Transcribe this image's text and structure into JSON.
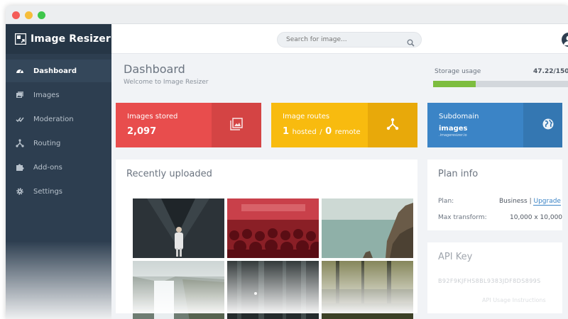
{
  "app": {
    "name": "Image Resizer"
  },
  "window": {
    "controls": [
      "close",
      "minimize",
      "maximize"
    ]
  },
  "sidebar": {
    "items": [
      {
        "label": "Dashboard",
        "icon": "dashboard-icon",
        "active": true
      },
      {
        "label": "Images",
        "icon": "images-icon",
        "active": false
      },
      {
        "label": "Moderation",
        "icon": "moderation-icon",
        "active": false
      },
      {
        "label": "Routing",
        "icon": "routing-icon",
        "active": false
      },
      {
        "label": "Add-ons",
        "icon": "puzzle-icon",
        "active": false
      },
      {
        "label": "Settings",
        "icon": "gear-icon",
        "active": false
      }
    ]
  },
  "search": {
    "placeholder": "Search for image..."
  },
  "header": {
    "title": "Dashboard",
    "subtitle": "Welcome to Image Resizer",
    "storage_label": "Storage usage",
    "storage_value": "47.22/150",
    "storage_fraction": 0.315
  },
  "cards": {
    "stored": {
      "label": "Images stored",
      "value": "2,097",
      "color": "#e84d4d"
    },
    "routes": {
      "label": "Image routes",
      "hosted_count": "1",
      "hosted_label": "hosted",
      "separator": "/",
      "remote_count": "0",
      "remote_label": "remote",
      "color": "#f8bb0f"
    },
    "subdomain": {
      "label": "Subdomain",
      "value": "images",
      "host": ".imageresizer.io",
      "color": "#3b84c6"
    }
  },
  "recent": {
    "title": "Recently uploaded",
    "thumbnails": [
      "concert-performer-photo",
      "concert-crowd-photo",
      "sea-cliff-photo",
      "waterfall-photo",
      "dark-forest-photo",
      "forest-light-photo"
    ]
  },
  "plan": {
    "title": "Plan info",
    "plan_label": "Plan:",
    "plan_value": "Business",
    "plan_sep": "|",
    "upgrade_label": "Upgrade",
    "max_label": "Max transform:",
    "max_value": "10,000 x 10,000"
  },
  "api": {
    "title": "API Key",
    "key": "B92F9KJFHS8BL9383JDF8DS899S",
    "instructions": "API Usage Instructions"
  }
}
